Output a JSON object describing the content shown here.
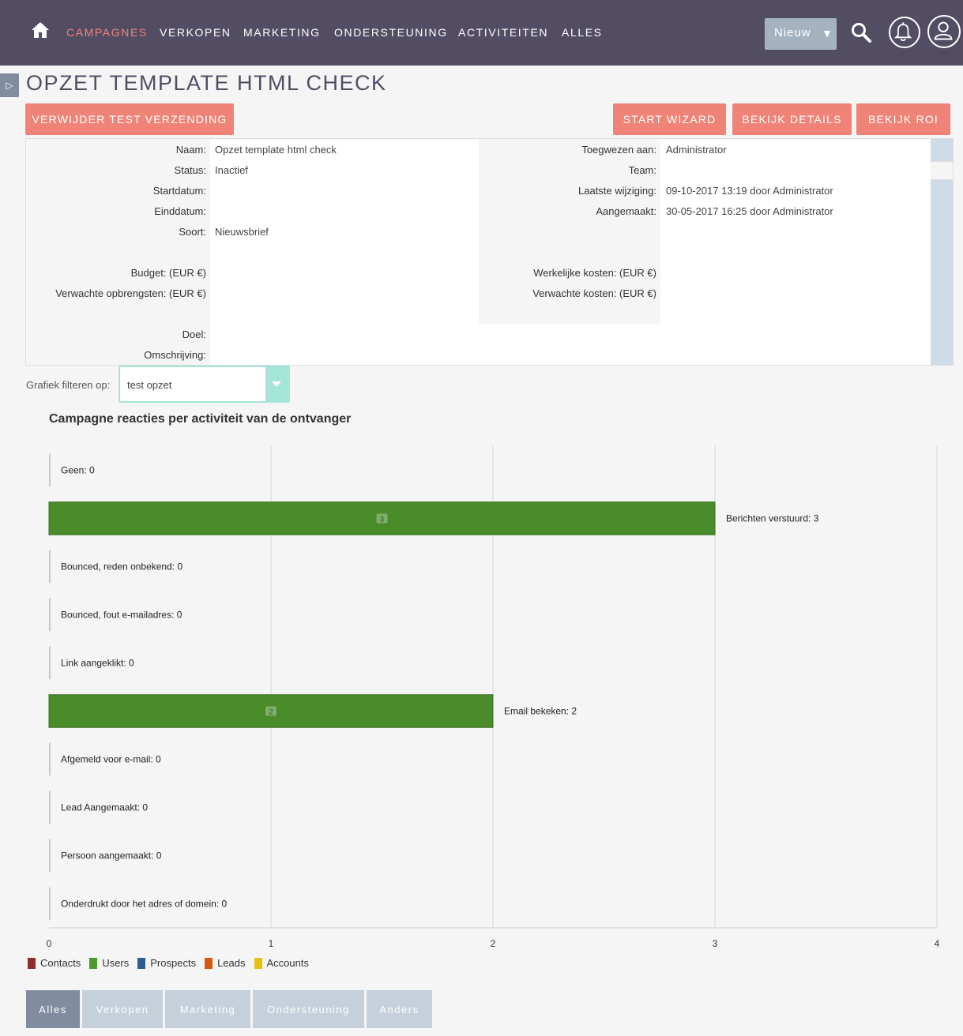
{
  "nav": {
    "items": [
      {
        "label": "CAMPAGNES",
        "active": true
      },
      {
        "label": "VERKOPEN",
        "active": false
      },
      {
        "label": "MARKETING",
        "active": false
      },
      {
        "label": "ONDERSTEUNING",
        "active": false
      },
      {
        "label": "ACTIVITEITEN",
        "active": false
      },
      {
        "label": "ALLES",
        "active": false
      }
    ],
    "new_label": "Nieuw",
    "icons": [
      "home-icon",
      "search-icon",
      "bell-icon",
      "user-icon"
    ]
  },
  "page": {
    "title": "OPZET TEMPLATE HTML CHECK"
  },
  "actions": {
    "delete_test": "VERWIJDER TEST VERZENDING",
    "start_wizard": "START WIZARD",
    "view_details": "BEKIJK DETAILS",
    "view_roi": "BEKIJK ROI"
  },
  "details": {
    "left": [
      {
        "label": "Naam:",
        "value": "Opzet template html check"
      },
      {
        "label": "Status:",
        "value": "Inactief"
      },
      {
        "label": "Startdatum:",
        "value": ""
      },
      {
        "label": "Einddatum:",
        "value": ""
      },
      {
        "label": "Soort:",
        "value": "Nieuwsbrief"
      },
      {
        "label": "",
        "value": ""
      },
      {
        "label": "Budget: (EUR €)",
        "value": ""
      },
      {
        "label": "Verwachte opbrengsten: (EUR €)",
        "value": ""
      },
      {
        "label": "",
        "value": ""
      },
      {
        "label": "Doel:",
        "value": ""
      },
      {
        "label": "Omschrijving:",
        "value": ""
      }
    ],
    "right": [
      {
        "label": "Toegwezen aan:",
        "value": "Administrator"
      },
      {
        "label": "Team:",
        "value": ""
      },
      {
        "label": "Laatste wijziging:",
        "value": "09-10-2017 13:19 door Administrator"
      },
      {
        "label": "Aangemaakt:",
        "value": "30-05-2017 16:25 door Administrator"
      },
      {
        "label": "",
        "value": ""
      },
      {
        "label": "",
        "value": ""
      },
      {
        "label": "Werkelijke kosten: (EUR €)",
        "value": ""
      },
      {
        "label": "Verwachte kosten: (EUR €)",
        "value": ""
      }
    ]
  },
  "filter": {
    "label": "Grafiek filteren op:",
    "value": "test opzet"
  },
  "chart_data": {
    "type": "bar",
    "orientation": "horizontal",
    "title": "Campagne reacties per activiteit van de ontvanger",
    "categories": [
      "Geen",
      "Berichten verstuurd",
      "Bounced, reden onbekend",
      "Bounced, fout e-mailadres",
      "Link aangeklikt",
      "Email bekeken",
      "Afgemeld voor e-mail",
      "Lead Aangemaakt",
      "Persoon aangemaakt",
      "Onderdrukt door het adres of domein"
    ],
    "values": [
      0,
      3,
      0,
      0,
      0,
      2,
      0,
      0,
      0,
      0
    ],
    "bar_color": "#4a8c2a",
    "xlim": [
      0,
      4
    ],
    "x_ticks": [
      "0",
      "1",
      "2",
      "3",
      "4"
    ],
    "grid": true,
    "legend": [
      {
        "name": "Contacts",
        "color": "#8b2d2d"
      },
      {
        "name": "Users",
        "color": "#4a9a2e"
      },
      {
        "name": "Prospects",
        "color": "#2f5e93"
      },
      {
        "name": "Leads",
        "color": "#d65a12"
      },
      {
        "name": "Accounts",
        "color": "#e6c20f"
      }
    ],
    "legend_position": "bottom-left"
  },
  "bottom_tabs": [
    {
      "label": "Alles",
      "active": true
    },
    {
      "label": "Verkopen",
      "active": false
    },
    {
      "label": "Marketing",
      "active": false
    },
    {
      "label": "Ondersteuning",
      "active": false
    },
    {
      "label": "Anders",
      "active": false
    }
  ]
}
